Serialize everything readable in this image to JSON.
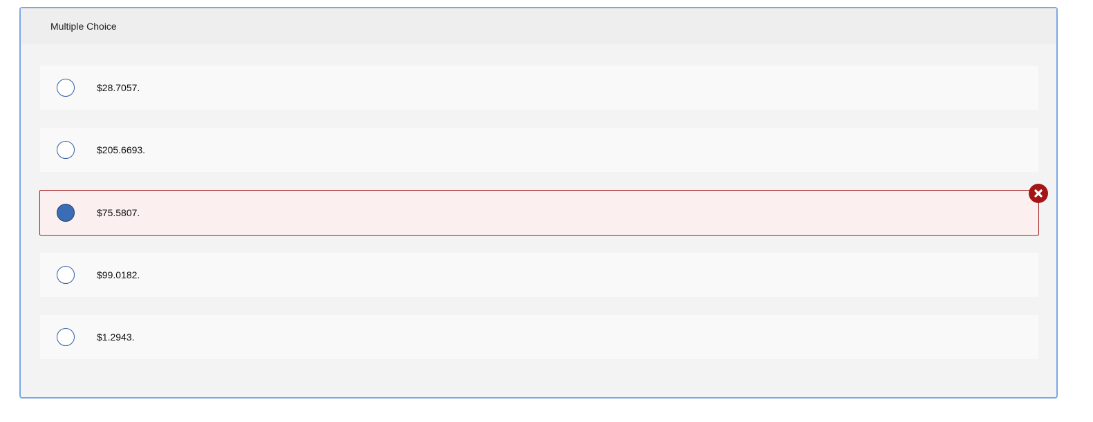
{
  "question": {
    "type_label": "Multiple Choice"
  },
  "options": [
    {
      "label": "$28.7057.",
      "selected": false,
      "status": "none"
    },
    {
      "label": "$205.6693.",
      "selected": false,
      "status": "none"
    },
    {
      "label": "$75.5807.",
      "selected": true,
      "status": "incorrect"
    },
    {
      "label": "$99.0182.",
      "selected": false,
      "status": "none"
    },
    {
      "label": "$1.2943.",
      "selected": false,
      "status": "none"
    }
  ],
  "colors": {
    "panel_border": "#7aa7e6",
    "radio_border": "#2e5c9e",
    "radio_selected": "#3a6db5",
    "incorrect_border": "#a31d1d",
    "incorrect_background": "#fbefef",
    "incorrect_icon": "#a41616"
  },
  "icons": {
    "incorrect": "close-circle-icon"
  }
}
